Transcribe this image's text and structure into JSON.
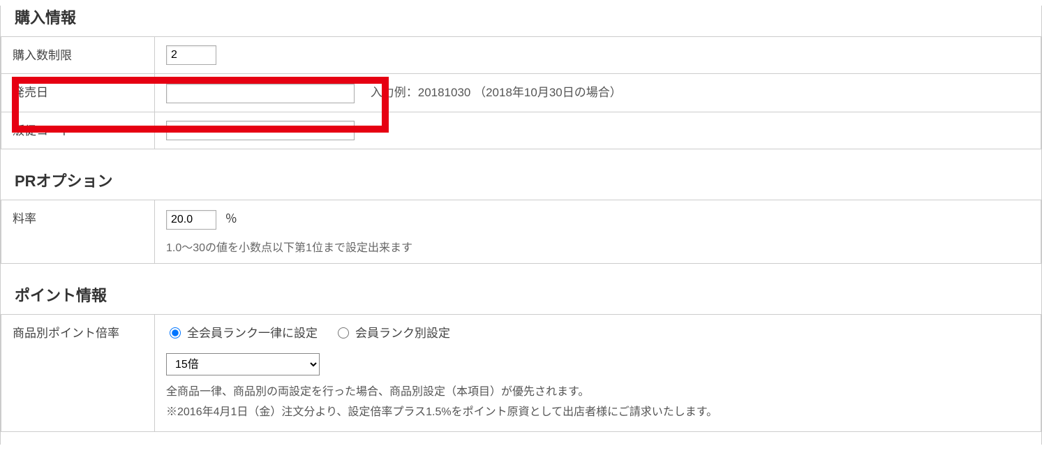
{
  "sections": {
    "purchase": {
      "title": "購入情報",
      "rows": {
        "limit": {
          "label": "購入数制限",
          "value": "2"
        },
        "releaseDate": {
          "label": "発売日",
          "value": "",
          "hint": "入力例：20181030 （2018年10月30日の場合）"
        },
        "promoCode": {
          "label": "販促コード",
          "value": ""
        }
      }
    },
    "pr": {
      "title": "PRオプション",
      "rows": {
        "rate": {
          "label": "料率",
          "value": "20.0",
          "unit": "％",
          "hint": "1.0〜30の値を小数点以下第1位まで設定出来ます"
        }
      }
    },
    "point": {
      "title": "ポイント情報",
      "rows": {
        "rate": {
          "label": "商品別ポイント倍率",
          "radios": {
            "uniform": "全会員ランク一律に設定",
            "byRank": "会員ランク別設定"
          },
          "selected": "15倍",
          "note1": "全商品一律、商品別の両設定を行った場合、商品別設定（本項目）が優先されます。",
          "note2": "※2016年4月1日（金）注文分より、設定倍率プラス1.5%をポイント原資として出店者様にご請求いたします。"
        }
      }
    }
  }
}
